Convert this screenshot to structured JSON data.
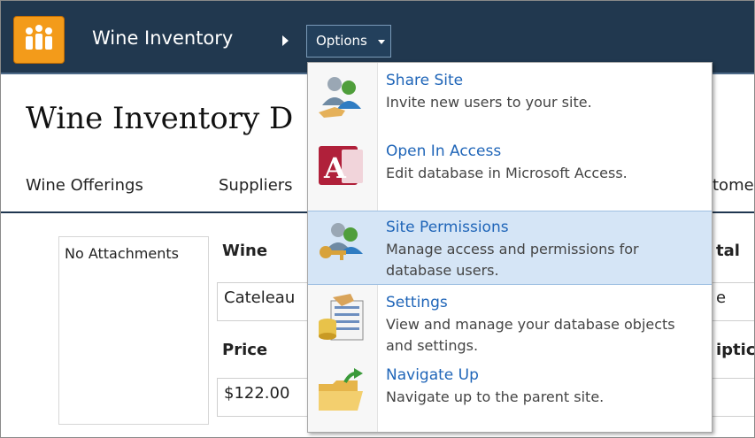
{
  "header": {
    "breadcrumb_title": "Wine Inventory",
    "options_label": "Options"
  },
  "page": {
    "title": "Wine Inventory D",
    "tabs": [
      "Wine Offerings",
      "Suppliers",
      "tome"
    ]
  },
  "form": {
    "attachments_text": "No Attachments",
    "wine_label": "Wine",
    "wine_value": "Cateleau",
    "price_label": "Price",
    "price_value": "$122.00",
    "total_label_fragment": "tal",
    "total_value_fragment": "e",
    "description_label_fragment": "iptic"
  },
  "options_menu": {
    "items": [
      {
        "title": "Share Site",
        "description": "Invite new users to your site.",
        "icon": "share-site-icon",
        "highlighted": false
      },
      {
        "title": "Open In Access",
        "description": "Edit database in Microsoft Access.",
        "icon": "access-icon",
        "highlighted": false
      },
      {
        "title": "Site Permissions",
        "description": "Manage access and permissions for database users.",
        "icon": "key-users-icon",
        "highlighted": true
      },
      {
        "title": "Settings",
        "description": "View and manage your database objects and settings.",
        "icon": "settings-icon",
        "highlighted": false
      },
      {
        "title": "Navigate Up",
        "description": "Navigate up to the parent site.",
        "icon": "folder-up-icon",
        "highlighted": false
      }
    ]
  },
  "colors": {
    "top_bar": "#21384f",
    "logo": "#f39b1a",
    "link_blue": "#1f65b8",
    "highlight": "#d5e5f6"
  }
}
